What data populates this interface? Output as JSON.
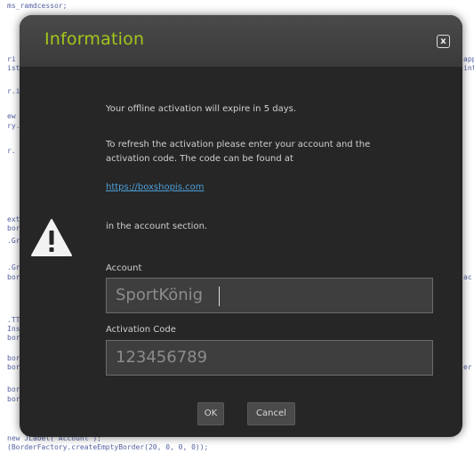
{
  "background_code": [
    "ms_ramdcessor;",
    "ri",
    "ist",
    "r.i",
    "ew",
    "ry.",
    "r.",
    "ext",
    "bor",
    ".Gr",
    ".Gr",
    "bor",
    ".TT",
    "Ins",
    "bor",
    "bor",
    "bor",
    "bor",
    "bor",
    "new JLabel( Account );",
    "(BorderFactory.createEmptyBorder(20, 0, 0, 0));"
  ],
  "background_code_right": [
    "app",
    "int",
    "ac",
    "er"
  ],
  "dialog": {
    "title": "Information",
    "close_glyph": "x",
    "message_line1": "Your offline activation will expire in 5 days.",
    "message_line2": "To refresh the activation please enter your account and the",
    "message_line3": "activation code. The code can be found at",
    "link": "https://boxshopis.com",
    "message_line4": "in the account section.",
    "account_label": "Account",
    "account_value": "SportKönig",
    "activation_label": "Activation Code",
    "activation_value": "123456789",
    "ok_label": "OK",
    "cancel_label": "Cancel"
  },
  "colors": {
    "title": "#a2c61c",
    "link": "#4d9fd8",
    "dialog_bg": "#262626",
    "field_bg": "#3e3e3e"
  },
  "icons": {
    "warning": "warning-icon",
    "close": "close-icon"
  }
}
